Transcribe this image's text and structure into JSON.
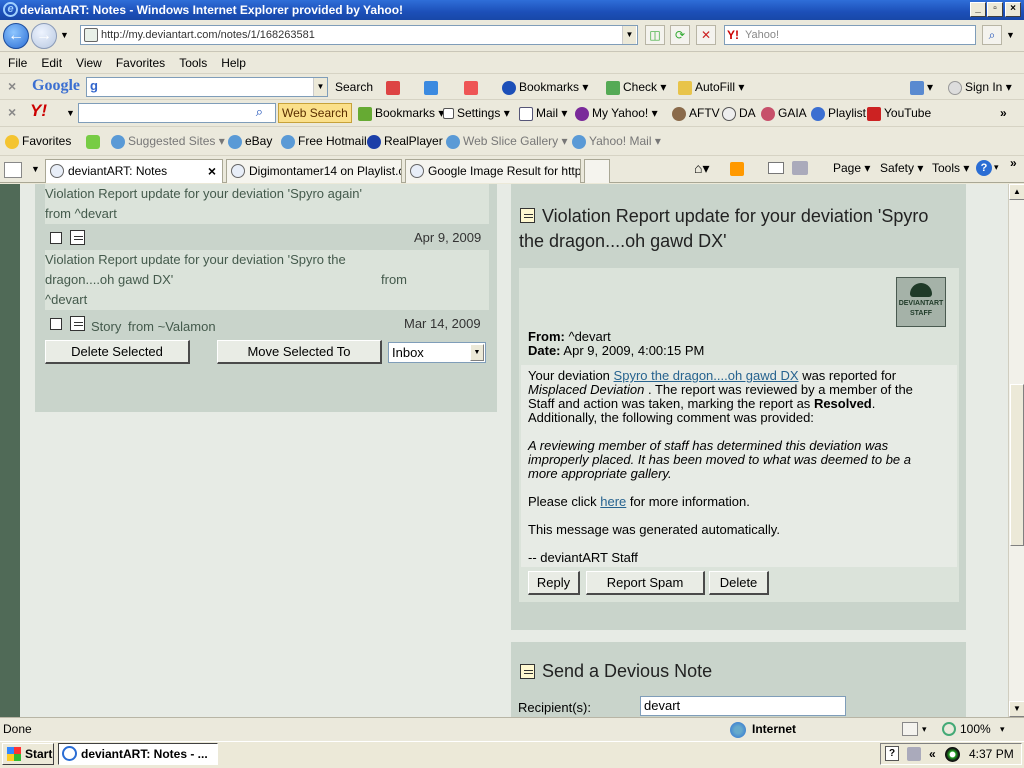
{
  "window": {
    "title": "deviantART: Notes - Windows Internet Explorer provided by Yahoo!"
  },
  "addressbar": {
    "url": "http://my.deviantart.com/notes/1/168263581",
    "search_placeholder": "Yahoo!"
  },
  "menu": [
    "File",
    "Edit",
    "View",
    "Favorites",
    "Tools",
    "Help"
  ],
  "google_toolbar": {
    "logo": "Google",
    "search": "Search",
    "bookmarks": "Bookmarks",
    "check": "Check",
    "autofill": "AutoFill",
    "signin": "Sign In"
  },
  "yahoo_toolbar": {
    "web_search": "Web Search",
    "bookmarks": "Bookmarks",
    "settings": "Settings",
    "mail": "Mail",
    "my_yahoo": "My Yahoo!",
    "links": [
      "AFTV",
      "DA",
      "GAIA",
      "Playlist",
      "YouTube"
    ]
  },
  "favorites_bar": {
    "favorites": "Favorites",
    "items": [
      "Suggested Sites",
      "eBay",
      "Free Hotmail",
      "RealPlayer",
      "Web Slice Gallery",
      "Yahoo! Mail"
    ]
  },
  "tabs": [
    {
      "label": "deviantART: Notes"
    },
    {
      "label": "Digimontamer14 on Playlist.co..."
    },
    {
      "label": "Google Image Result for http:..."
    }
  ],
  "command_bar": {
    "page": "Page",
    "safety": "Safety",
    "tools": "Tools"
  },
  "notes_list": {
    "item1_subject": "Violation Report update for your deviation 'Spyro again'",
    "item1_from": "from ^devart",
    "item2_date": "Apr 9, 2009",
    "item2_subject_a": "Violation Report update for your deviation 'Spyro the",
    "item2_subject_b": "dragon....oh gawd DX'",
    "item2_from": "from",
    "item2_sender": "^devart",
    "item3_subject": "Story",
    "item3_from": "from ~Valamon",
    "item3_date": "Mar 14, 2009",
    "delete_selected": "Delete Selected",
    "move_selected": "Move Selected To",
    "folder": "Inbox"
  },
  "note": {
    "title_a": "Violation Report update for your deviation 'Spyro",
    "title_b": "the dragon....oh gawd DX'",
    "badge_a": "DEVIANTART",
    "badge_b": "STAFF",
    "from_label": "From:",
    "from_value": "^devart",
    "date_label": "Date:",
    "date_value": "Apr 9, 2009, 4:00:15 PM",
    "p1_a": "Your deviation",
    "p1_link": "Spyro the dragon....oh gawd DX",
    "p1_b": "was reported for",
    "p1_c": "Misplaced Deviation",
    "p1_d": ". The report was reviewed by a member of the",
    "p1_e": "Staff and action was taken, marking the report as",
    "p1_f": "Resolved",
    "p1_g": "Additionally, the following comment was provided:",
    "comment_a": "A reviewing member of staff has determined this deviation was",
    "comment_b": "improperly placed. It has been moved to what was deemed to be a",
    "comment_c": "more appropriate gallery.",
    "p2_a": "Please click",
    "p2_link": "here",
    "p2_b": "for more information.",
    "p3": "This message was generated automatically.",
    "signature": "-- deviantART Staff",
    "reply": "Reply",
    "report_spam": "Report Spam",
    "delete": "Delete"
  },
  "send_note": {
    "title": "Send a Devious Note",
    "recipient_label": "Recipient(s):",
    "recipient_value": "devart"
  },
  "statusbar": {
    "status": "Done",
    "zone": "Internet",
    "zoom": "100%"
  },
  "taskbar": {
    "start": "Start",
    "item": "deviantART: Notes - ...",
    "clock": "4:37 PM"
  }
}
